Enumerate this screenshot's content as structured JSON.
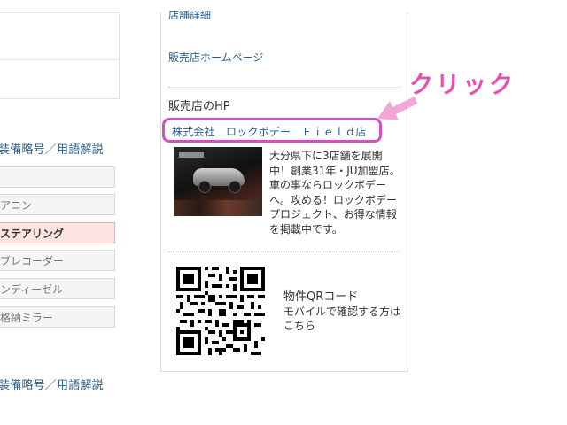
{
  "left": {
    "section_title_1": "装備略号／用語解説",
    "section_title_2": "装備略号／用語解説",
    "equipment_items": [
      {
        "label": ""
      },
      {
        "label": "アコン"
      },
      {
        "label": "ステアリング",
        "active": true
      },
      {
        "label": "ブレコーダー"
      },
      {
        "label": "ンディーゼル"
      },
      {
        "label": "格納ミラー"
      }
    ]
  },
  "panel": {
    "cut_link": "店舗詳細",
    "home_link": "販売店ホームページ",
    "hp_title": "販売店のHP",
    "store_link": "株式会社　ロックボデー　Ｆｉｅｌｄ店",
    "store_desc": "大分県下に3店舗を展開中！創業31年・JU加盟店。車の事ならロックボデーへ。攻める！ロックボデープロジェクト、お得な情報を掲載中です。",
    "qr_title": "物件QRコード",
    "qr_desc": "モバイルで確認する方はこちら"
  },
  "annotation": {
    "click_label": "クリック",
    "color": "#e84fb0",
    "highlight_color": "#d44fc0"
  },
  "icons": {
    "arrow": "arrow-pointer-icon",
    "qr": "qr-code-icon"
  }
}
